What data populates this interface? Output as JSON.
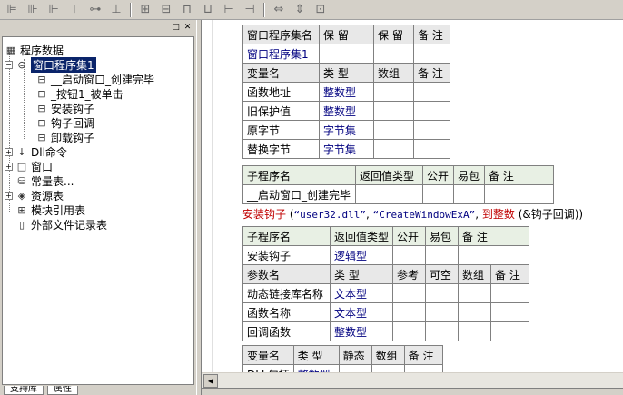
{
  "toolbar": {
    "icons": [
      "align-left-icon",
      "align-center-icon",
      "align-right-icon",
      "align-top-icon",
      "align-middle-icon",
      "align-bottom-icon",
      "center-h-icon",
      "center-v-icon",
      "space-h-icon",
      "space-v-icon",
      "same-width-icon",
      "same-height-icon",
      "same-size-icon"
    ]
  },
  "panel": {
    "pin_glyph": "□",
    "close_glyph": "✕"
  },
  "tree": {
    "root": "程序数据",
    "assembly": "窗口程序集1",
    "subs": [
      "__启动窗口_创建完毕",
      "_按钮1_被单击",
      "安装钩子",
      "钩子回调",
      "卸载钩子"
    ],
    "items": [
      "Dll命令",
      "窗口",
      "常量表...",
      "资源表",
      "模块引用表",
      "外部文件记录表"
    ]
  },
  "bottom_tabs": [
    "支持库",
    "属性"
  ],
  "assembly_table": {
    "header": [
      "窗口程序集名",
      "保 留",
      "保 留",
      "备 注"
    ],
    "row": [
      "窗口程序集1",
      "",
      "",
      ""
    ],
    "var_header": [
      "变量名",
      "类 型",
      "数组",
      "备 注"
    ],
    "vars": [
      {
        "name": "函数地址",
        "type": "整数型"
      },
      {
        "name": "旧保护值",
        "type": "整数型"
      },
      {
        "name": "原字节",
        "type": "字节集"
      },
      {
        "name": "替换字节",
        "type": "字节集"
      }
    ]
  },
  "sub1_table": {
    "header": [
      "子程序名",
      "返回值类型",
      "公开",
      "易包",
      "备 注"
    ],
    "row": [
      "__启动窗口_创建完毕",
      "",
      "",
      "",
      ""
    ]
  },
  "code_line": {
    "func": "安装钩子",
    "open": " (",
    "arg1": "“user32.dll”",
    "comma1": ", ",
    "arg2": "“CreateWindowExA”",
    "comma2": ", ",
    "arg3": "到整数",
    "rest": " (&钩子回调))"
  },
  "sub2_table": {
    "header": [
      "子程序名",
      "返回值类型",
      "公开",
      "易包",
      "备 注"
    ],
    "row": {
      "name": "安装钩子",
      "type": "逻辑型"
    },
    "param_header": [
      "参数名",
      "类 型",
      "参考",
      "可空",
      "数组",
      "备 注"
    ],
    "params": [
      {
        "name": "动态链接库名称",
        "type": "文本型"
      },
      {
        "name": "函数名称",
        "type": "文本型"
      },
      {
        "name": "回调函数",
        "type": "整数型"
      }
    ]
  },
  "local_table": {
    "header": [
      "变量名",
      "类 型",
      "静态",
      "数组",
      "备 注"
    ],
    "row": {
      "name": "DLL句柄",
      "type": "整数型"
    }
  }
}
